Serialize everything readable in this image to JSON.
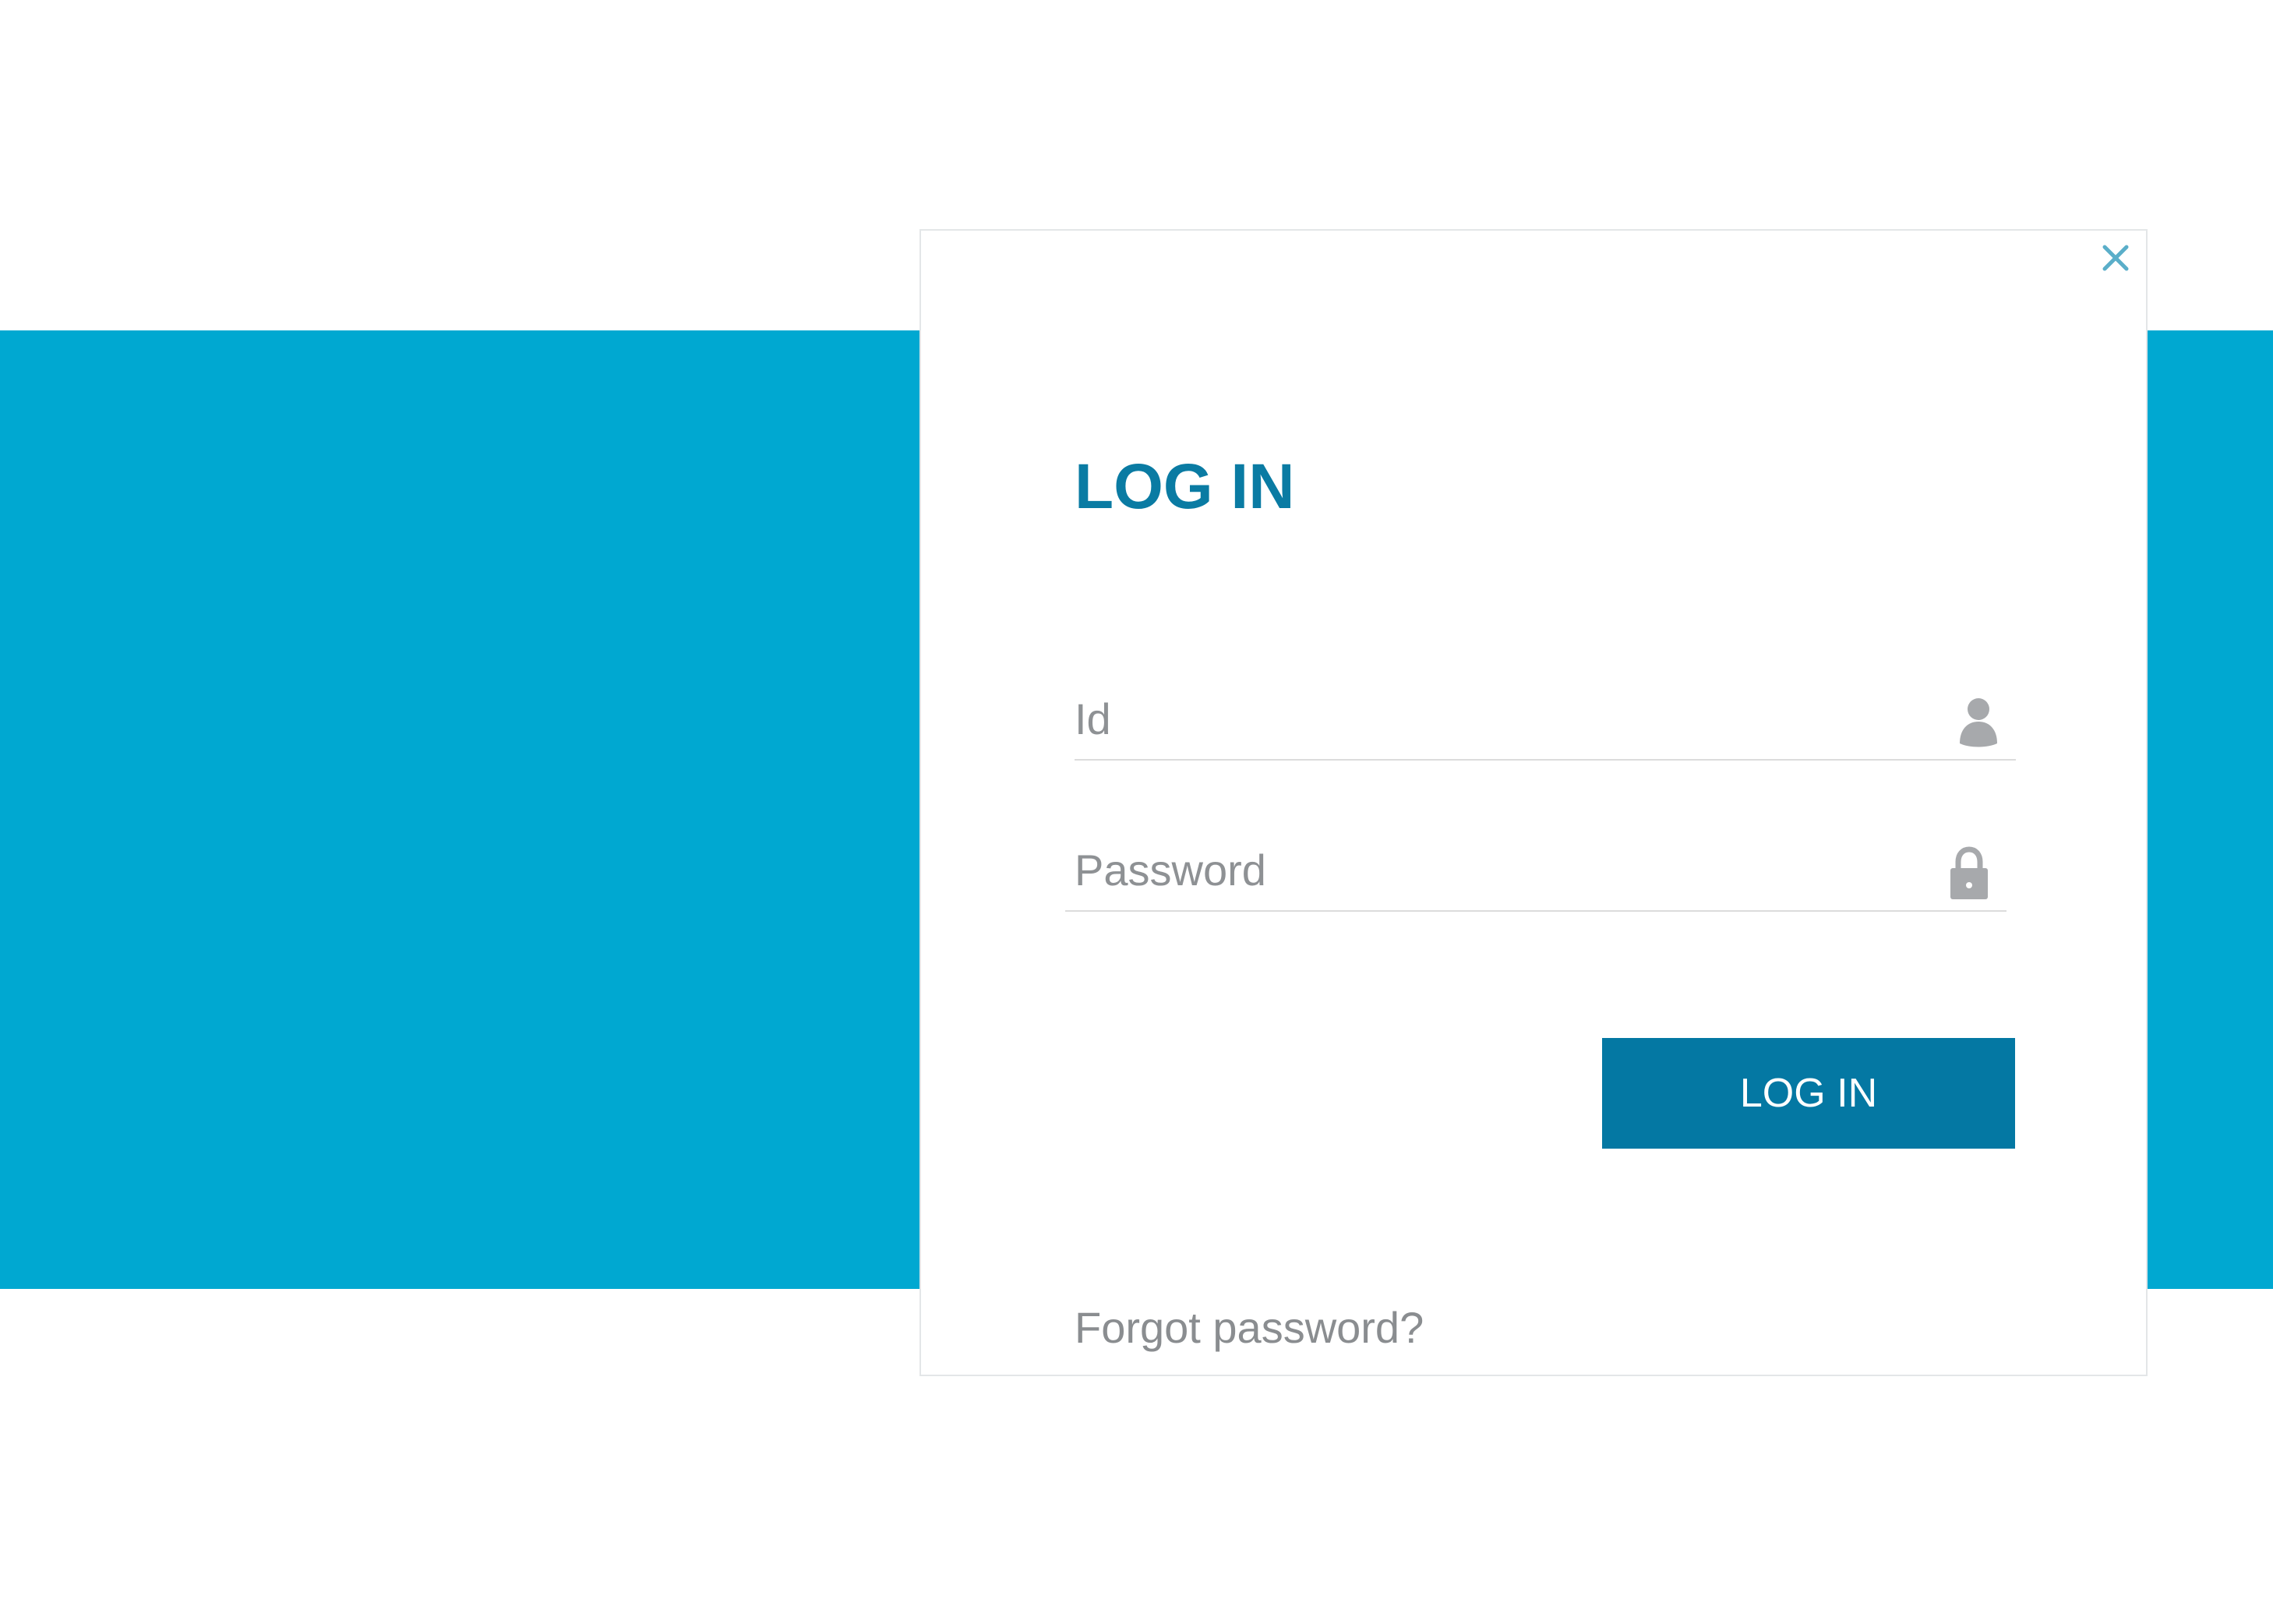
{
  "dialog": {
    "title": "LOG IN",
    "close_icon": "close-icon",
    "id_field": {
      "placeholder": "Id",
      "value": "",
      "icon": "user-icon"
    },
    "password_field": {
      "placeholder": "Password",
      "value": "",
      "icon": "lock-icon"
    },
    "forgot_label": "Forgot password?",
    "login_label": "LOG IN"
  },
  "colors": {
    "band": "#00a8d1",
    "accent": "#0a7ba3",
    "button": "#0478a3",
    "placeholder": "#8e9194",
    "icon": "#a7a9ac",
    "close": "#5aaec9"
  }
}
